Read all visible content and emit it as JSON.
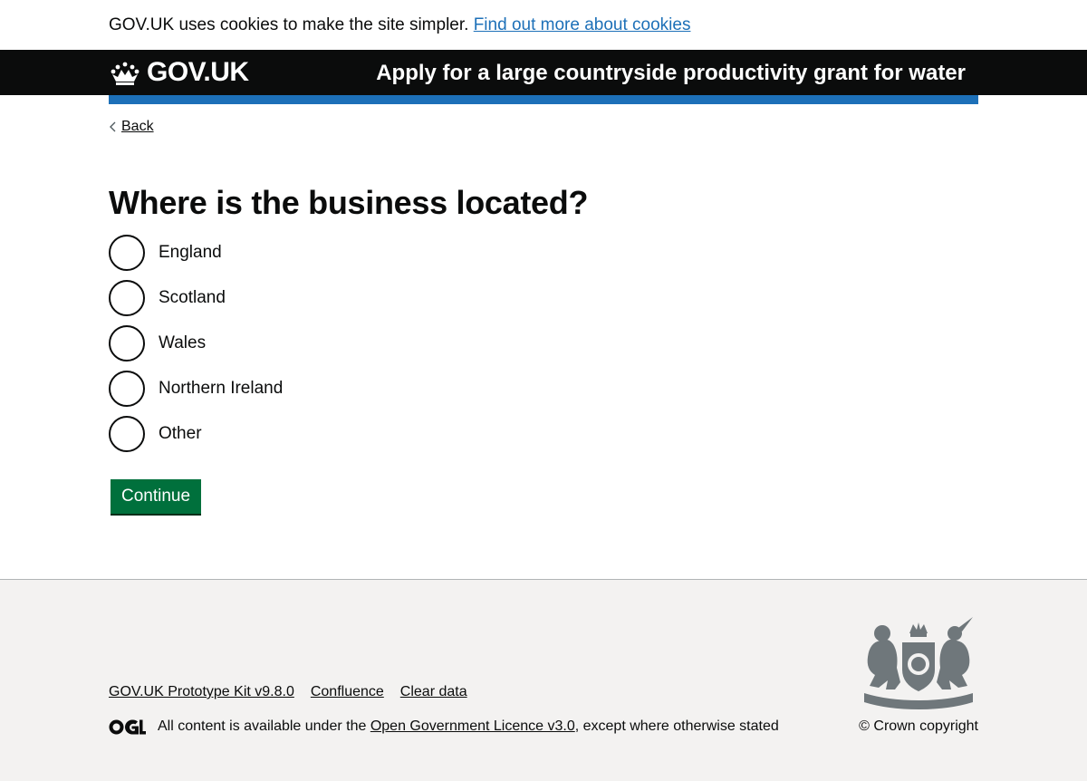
{
  "cookie_banner": {
    "message": "GOV.UK uses cookies to make the site simpler.",
    "link_label": "Find out more about cookies"
  },
  "header": {
    "logo_text": "GOV.UK",
    "service_name": "Apply for a large countryside productivity grant for water"
  },
  "back_link": {
    "label": "Back"
  },
  "question": {
    "title": "Where is the business located?",
    "options": [
      "England",
      "Scotland",
      "Wales",
      "Northern Ireland",
      "Other"
    ]
  },
  "continue_button": {
    "label": "Continue"
  },
  "footer": {
    "links": [
      "GOV.UK Prototype Kit v9.8.0",
      "Confluence",
      "Clear data"
    ],
    "licence_prefix": "All content is available under the",
    "licence_link": "Open Government Licence v3.0",
    "licence_suffix": ", except where otherwise stated",
    "copyright": "© Crown copyright",
    "icons": [
      "crown-icon",
      "ogl-logo-icon",
      "royal-coat-of-arms-icon"
    ]
  },
  "colors": {
    "header_bg": "#0b0c0c",
    "brand_blue": "#1d70b8",
    "button_green": "#00703c",
    "footer_bg": "#f3f2f1",
    "link_blue": "#1d70b8"
  }
}
